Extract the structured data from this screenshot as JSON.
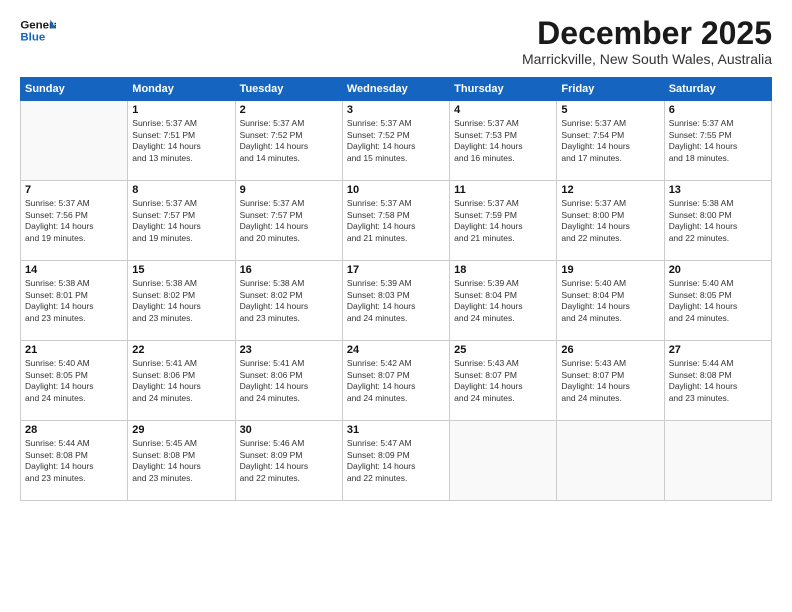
{
  "header": {
    "logo_line1": "General",
    "logo_line2": "Blue",
    "title": "December 2025",
    "location": "Marrickville, New South Wales, Australia"
  },
  "days_of_week": [
    "Sunday",
    "Monday",
    "Tuesday",
    "Wednesday",
    "Thursday",
    "Friday",
    "Saturday"
  ],
  "weeks": [
    [
      {
        "day": "",
        "info": ""
      },
      {
        "day": "1",
        "info": "Sunrise: 5:37 AM\nSunset: 7:51 PM\nDaylight: 14 hours\nand 13 minutes."
      },
      {
        "day": "2",
        "info": "Sunrise: 5:37 AM\nSunset: 7:52 PM\nDaylight: 14 hours\nand 14 minutes."
      },
      {
        "day": "3",
        "info": "Sunrise: 5:37 AM\nSunset: 7:52 PM\nDaylight: 14 hours\nand 15 minutes."
      },
      {
        "day": "4",
        "info": "Sunrise: 5:37 AM\nSunset: 7:53 PM\nDaylight: 14 hours\nand 16 minutes."
      },
      {
        "day": "5",
        "info": "Sunrise: 5:37 AM\nSunset: 7:54 PM\nDaylight: 14 hours\nand 17 minutes."
      },
      {
        "day": "6",
        "info": "Sunrise: 5:37 AM\nSunset: 7:55 PM\nDaylight: 14 hours\nand 18 minutes."
      }
    ],
    [
      {
        "day": "7",
        "info": "Sunrise: 5:37 AM\nSunset: 7:56 PM\nDaylight: 14 hours\nand 19 minutes."
      },
      {
        "day": "8",
        "info": "Sunrise: 5:37 AM\nSunset: 7:57 PM\nDaylight: 14 hours\nand 19 minutes."
      },
      {
        "day": "9",
        "info": "Sunrise: 5:37 AM\nSunset: 7:57 PM\nDaylight: 14 hours\nand 20 minutes."
      },
      {
        "day": "10",
        "info": "Sunrise: 5:37 AM\nSunset: 7:58 PM\nDaylight: 14 hours\nand 21 minutes."
      },
      {
        "day": "11",
        "info": "Sunrise: 5:37 AM\nSunset: 7:59 PM\nDaylight: 14 hours\nand 21 minutes."
      },
      {
        "day": "12",
        "info": "Sunrise: 5:37 AM\nSunset: 8:00 PM\nDaylight: 14 hours\nand 22 minutes."
      },
      {
        "day": "13",
        "info": "Sunrise: 5:38 AM\nSunset: 8:00 PM\nDaylight: 14 hours\nand 22 minutes."
      }
    ],
    [
      {
        "day": "14",
        "info": "Sunrise: 5:38 AM\nSunset: 8:01 PM\nDaylight: 14 hours\nand 23 minutes."
      },
      {
        "day": "15",
        "info": "Sunrise: 5:38 AM\nSunset: 8:02 PM\nDaylight: 14 hours\nand 23 minutes."
      },
      {
        "day": "16",
        "info": "Sunrise: 5:38 AM\nSunset: 8:02 PM\nDaylight: 14 hours\nand 23 minutes."
      },
      {
        "day": "17",
        "info": "Sunrise: 5:39 AM\nSunset: 8:03 PM\nDaylight: 14 hours\nand 24 minutes."
      },
      {
        "day": "18",
        "info": "Sunrise: 5:39 AM\nSunset: 8:04 PM\nDaylight: 14 hours\nand 24 minutes."
      },
      {
        "day": "19",
        "info": "Sunrise: 5:40 AM\nSunset: 8:04 PM\nDaylight: 14 hours\nand 24 minutes."
      },
      {
        "day": "20",
        "info": "Sunrise: 5:40 AM\nSunset: 8:05 PM\nDaylight: 14 hours\nand 24 minutes."
      }
    ],
    [
      {
        "day": "21",
        "info": "Sunrise: 5:40 AM\nSunset: 8:05 PM\nDaylight: 14 hours\nand 24 minutes."
      },
      {
        "day": "22",
        "info": "Sunrise: 5:41 AM\nSunset: 8:06 PM\nDaylight: 14 hours\nand 24 minutes."
      },
      {
        "day": "23",
        "info": "Sunrise: 5:41 AM\nSunset: 8:06 PM\nDaylight: 14 hours\nand 24 minutes."
      },
      {
        "day": "24",
        "info": "Sunrise: 5:42 AM\nSunset: 8:07 PM\nDaylight: 14 hours\nand 24 minutes."
      },
      {
        "day": "25",
        "info": "Sunrise: 5:43 AM\nSunset: 8:07 PM\nDaylight: 14 hours\nand 24 minutes."
      },
      {
        "day": "26",
        "info": "Sunrise: 5:43 AM\nSunset: 8:07 PM\nDaylight: 14 hours\nand 24 minutes."
      },
      {
        "day": "27",
        "info": "Sunrise: 5:44 AM\nSunset: 8:08 PM\nDaylight: 14 hours\nand 23 minutes."
      }
    ],
    [
      {
        "day": "28",
        "info": "Sunrise: 5:44 AM\nSunset: 8:08 PM\nDaylight: 14 hours\nand 23 minutes."
      },
      {
        "day": "29",
        "info": "Sunrise: 5:45 AM\nSunset: 8:08 PM\nDaylight: 14 hours\nand 23 minutes."
      },
      {
        "day": "30",
        "info": "Sunrise: 5:46 AM\nSunset: 8:09 PM\nDaylight: 14 hours\nand 22 minutes."
      },
      {
        "day": "31",
        "info": "Sunrise: 5:47 AM\nSunset: 8:09 PM\nDaylight: 14 hours\nand 22 minutes."
      },
      {
        "day": "",
        "info": ""
      },
      {
        "day": "",
        "info": ""
      },
      {
        "day": "",
        "info": ""
      }
    ]
  ]
}
